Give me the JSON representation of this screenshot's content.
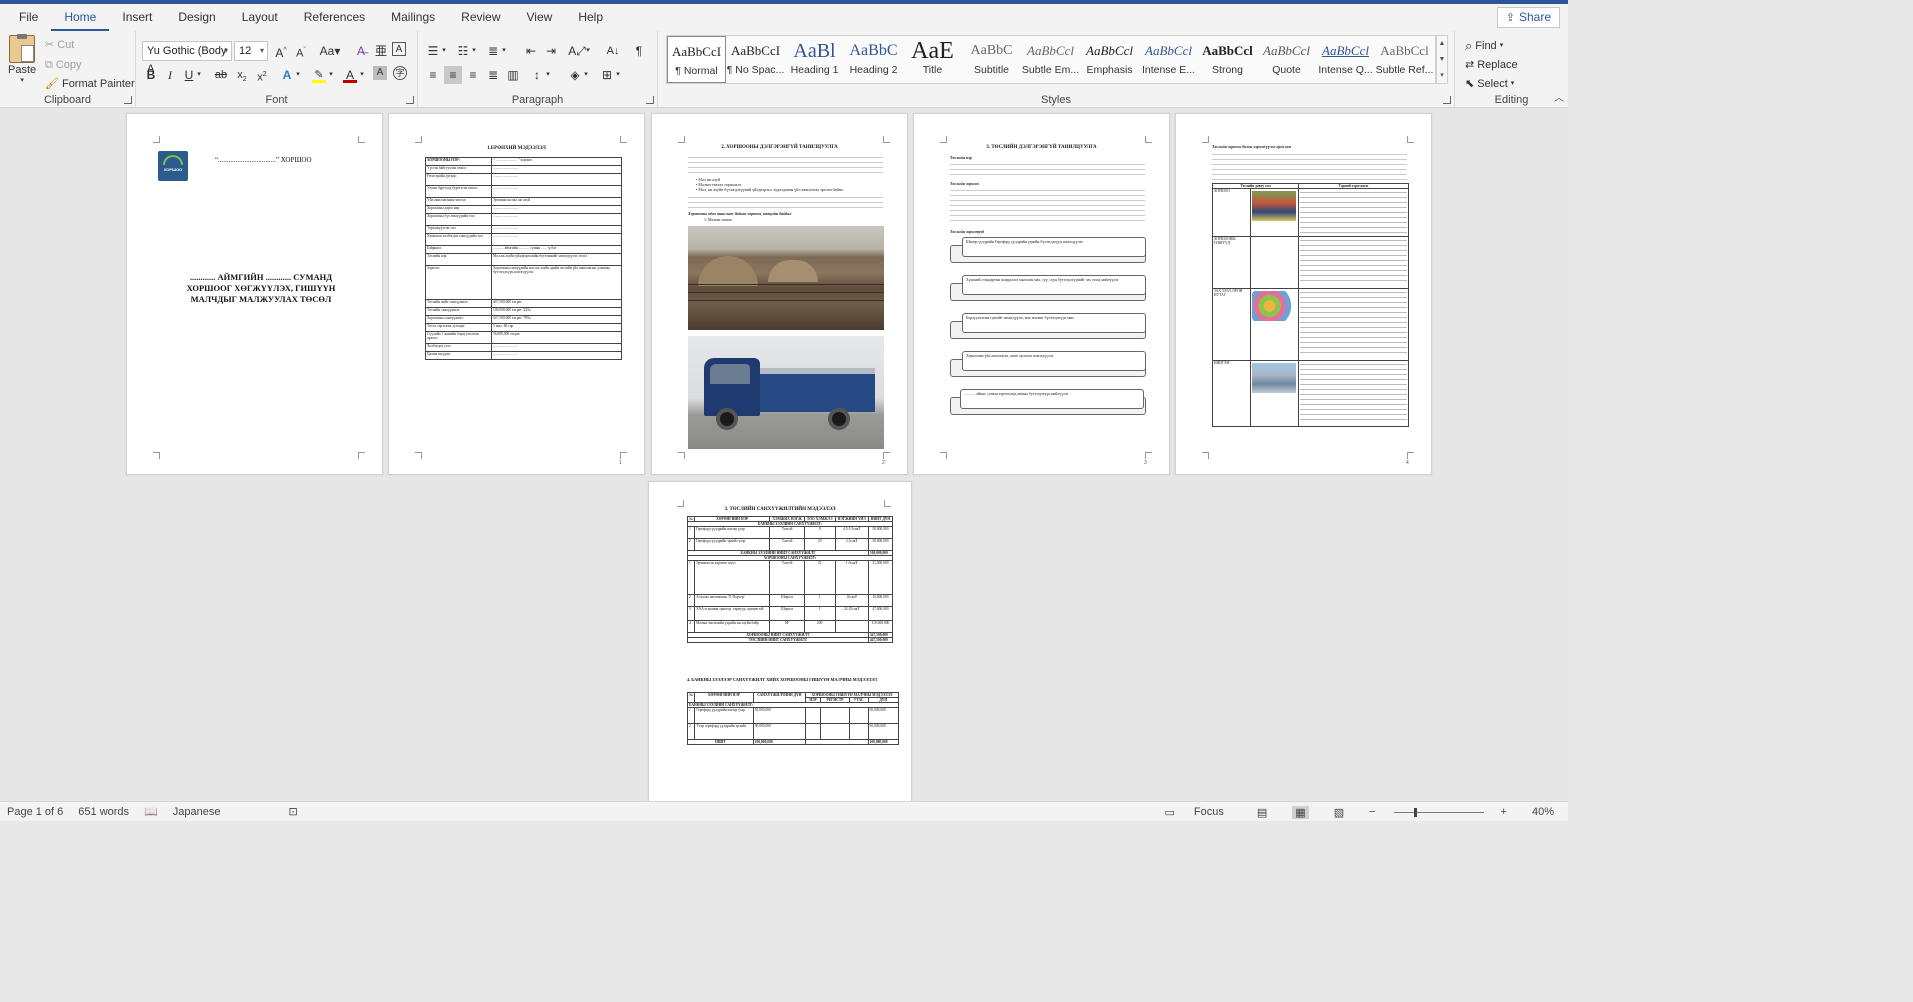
{
  "tabs": [
    "File",
    "Home",
    "Insert",
    "Design",
    "Layout",
    "References",
    "Mailings",
    "Review",
    "View",
    "Help"
  ],
  "active_tab": "Home",
  "share_label": "Share",
  "clipboard": {
    "label": "Clipboard",
    "paste": "Paste",
    "cut": "Cut",
    "copy": "Copy",
    "format_painter": "Format Painter"
  },
  "font": {
    "label": "Font",
    "family": "Yu Gothic (Body A",
    "size": "12",
    "font_color": "#c00000",
    "highlight_color": "#ffff00"
  },
  "paragraph": {
    "label": "Paragraph"
  },
  "styles": {
    "label": "Styles",
    "items": [
      {
        "preview": "AaBbCcI",
        "name": "¶ Normal"
      },
      {
        "preview": "AaBbCcI",
        "name": "¶ No Spac..."
      },
      {
        "preview": "AaBl",
        "name": "Heading 1"
      },
      {
        "preview": "AaBbC",
        "name": "Heading 2"
      },
      {
        "preview": "AaE",
        "name": "Title"
      },
      {
        "preview": "AaBbC",
        "name": "Subtitle"
      },
      {
        "preview": "AaBbCcl",
        "name": "Subtle Em..."
      },
      {
        "preview": "AaBbCcl",
        "name": "Emphasis"
      },
      {
        "preview": "AaBbCcl",
        "name": "Intense E..."
      },
      {
        "preview": "AaBbCcl",
        "name": "Strong"
      },
      {
        "preview": "AaBbCcl",
        "name": "Quote"
      },
      {
        "preview": "AaBbCcl",
        "name": "Intense Q..."
      },
      {
        "preview": "AaBbCcl",
        "name": "Subtle Ref..."
      }
    ]
  },
  "editing": {
    "label": "Editing",
    "find": "Find",
    "replace": "Replace",
    "select": "Select"
  },
  "pages": {
    "p1": {
      "header": "“.................................” ХОРШОО",
      "title": "............ АЙМГИЙН ............ СУМАНД ХОРШООГ ХӨГЖҮҮЛЭХ, ГИШҮҮН МАЛЧДЫГ МАЛЖУУЛАХ ТӨСӨЛ"
    },
    "p2": {
      "title": "1.ЕРӨНХИЙ МЭДЭЭЛЭЛ",
      "rows": [
        [
          "ХОРШООНЫ НЭР:",
          "“ ........................ ” хоршоо"
        ],
        [
          "Үүсгэн байгуулсан огноо:",
          "............................"
        ],
        [
          "Регистрийн дугаар:",
          "............................"
        ],
        [
          "Улсын бүртгэлд бүртгэсэн огноо:",
          "............................"
        ],
        [
          "Үйл ажиллагааны чиглэл:",
          "Эрчимжсэн мал аж ахуй"
        ],
        [
          "Хоршооны дарга нэр:",
          "............................"
        ],
        [
          "Хоршооны бүх гишүүдийн тоо:",
          "............................"
        ],
        [
          "Төрөлжүүлсэн тоо:",
          "............................"
        ],
        [
          "Хамаатан холбогдон гишүүдийн тоо:",
          "............................"
        ],
        [
          "Байршил:",
          "............ аймгийн ............ сумын ...... -р баг"
        ],
        [
          "Төслийн нэр:",
          "Мал аж ахуйн үйлдвэрлэлийн бүтээмжийг нэмэгдүүлэх төсөл"
        ],
        [
          "Зорилго:",
          "Хоршооны гишүүдийн мал аж ахуйн эдийн засгийн үйл ажиллагааг дэмжин, бүтээгдэхүүн нэмэгдүүлэх"
        ],
        [
          "Төслийн нийт санхүүжилт:",
          "447,500,000 төгрөг"
        ],
        [
          "Төслийн санхүүжилт:",
          "100,000,000 төгрөг /22%/"
        ],
        [
          "Хоршооны санхүүжилт:",
          "347,500,000 төгрөг /78%/"
        ],
        [
          "Төсөл хэрэгжих хугацаа:",
          "5 жил, 60 сар"
        ],
        [
          "Сүүлийн 1 жилийн борлуулалтын орлого:",
          "56,000,000 төгрөг"
        ],
        [
          "Холбогдох утас:",
          "............................"
        ],
        [
          "Цахим шуудан:",
          "............................"
        ]
      ]
    },
    "p3": {
      "title": "2.  ХОРШООНЫ ДЭЛГЭРЭНГҮЙ ТАНИЛЦУУЛГА",
      "bullets": [
        "Мал аж ахуй",
        "Малын тэжээл тариалалт",
        "Мал, аж ахуйн бүтээгдэхүүний үйлдвэрлэл, худалдааны үйл ажиллагаа эрхлэн байна."
      ],
      "subheading": "Хоршооны одоо ашиглаж байгаа хөрөнгө, нөөцийн байдал",
      "caption": "Малын хашаа"
    },
    "p4": {
      "title": "3.  ТӨСЛИЙН ДЭЛГЭРЭНГҮЙ ТАНИЛЦУУЛГА",
      "s1": "Төслийн нэр",
      "s2": "Төслийн зорилго",
      "s3": "Төслийн зорилтууд",
      "boxes": [
        "Шилэр үүлдрийн Герефорд үүлдрийн үхрийн бүтээгдэхүүн нэмэгдүүлэх",
        "Хүнсний стандартын шаардлага хангасан мах, сүү, сүүн бүтээгдэхүүнийг зах зээлд нийлүүлэх",
        "Борлуулалтын сувгийг нэмэгдүүлж, мах махмиг бүтээгдэхүүн авах",
        "Хоршооны үйл ажиллагаа, ашиг орлогыг нэмэгдүүлэх",
        "............ аймаг, сумын хэрэгцээнд махны бүтээгдэхүүн нийлүүлэх"
      ]
    },
    "p5": {
      "intro": "Төслийн зорилго болон хэрэгжүүлэх арга зам",
      "head": [
        "Төслийн давуу тал",
        "Тэрний хэрэгжилт"
      ],
      "rows": [
        "ХОРШОО",
        "ХОРШООНЫ ГИШҮҮД",
        "ЗАХ ЗЭЭЛ, ОРОН НУТАГ",
        "НИЙГЭМ"
      ]
    },
    "p6": {
      "title": "3.  ТӨСЛИЙН САНХҮҮЖИЛТИЙН МЭДЭЭЛЭЛ",
      "head": [
        "№",
        "ХӨРӨНГИЙН НЭР",
        "ХЭМЖИХ НЭГЖ",
        "ТОО ХЭМЖЭЭ",
        "НЭГЖИЙН ҮНЭ",
        "НИЙТ ДҮН"
      ],
      "bank_label": "БАНКНЫ ЗЭЭЛИЙН САНХҮҮЖИЛТ:",
      "bank_rows": [
        [
          "1",
          "Герефорд үүлдрийн шилэр үхэр",
          "Толгой",
          "9",
          "4.5-5.5сая₮",
          "50,000,000"
        ],
        [
          "2",
          "Герефорд үүлдрийн эрлийз үхэр",
          "Толгой",
          "20",
          "2.5сая₮",
          "50,000,000"
        ]
      ],
      "bank_total": [
        "БАНКНЫ ЗЭЭЛИЙН НИЙТ САНХҮҮЖИЛТ",
        "100,000,000"
      ],
      "coop_label": "ХОРШООНЫ САНХҮҮЖИЛТ:",
      "coop_rows": [
        [
          "1",
          "Эрчимжсэн хөрөнгө шуут",
          "Толгой",
          "21",
          "1.0сая₮",
          "21,000,000"
        ],
        [
          "2",
          "Алхалах автомашин /Х-Портер/",
          "Ширхэг",
          "1",
          "16сая₮",
          "16,000,000"
        ],
        [
          "3",
          "ХАА-н машин трактор, тармуур, прицептэй",
          "Ширхэг",
          "1",
          "22-25сая₮",
          "47,000,000"
        ],
        [
          "4",
          "Малын чиглэлийн үхрийн аж ахуйн байр",
          "М²",
          "200",
          "",
          "110,000,000"
        ]
      ],
      "coop_total": [
        "ХОРШООНЫ НИЙТ САНХҮҮЖИЛТ",
        "347,500,000"
      ],
      "grand_total": [
        "ТӨСЛИЙН НИЙТ САНХҮҮЖИЛТ",
        "447,500,000"
      ],
      "title2": "4.  БАНКНЫ ЗЭЭЛЭЭР САНХҮҮЖИЛТ ХИЙХ ХОРШООНЫ ГИШҮҮН МАЛЧНЫ МЭДЭЭЛЭЛ",
      "head2": [
        "№",
        "ХӨРӨНГИЙН НЭР",
        "САНХҮҮЖИЛТИЙН ДҮН",
        "НЭР",
        "РЕГИСТР",
        "УТАС",
        "ДҮН"
      ],
      "head2_group": "ХОРШООНЫ ГИШҮҮН МАЛЧНЫ МЭДЭЭЛЭЛ",
      "rows2": [
        [
          "1",
          "Герефорд үүлдрийн шилэр үхэр",
          "50,000,000",
          "50,000,000"
        ],
        [
          "2",
          "Үхэр герефорд үүлдрийн эрлийз",
          "50,000,000",
          "50,000,000"
        ]
      ],
      "total2": [
        "НИЙТ",
        "100,000,000",
        "100,000,000"
      ]
    },
    "page_numbers": [
      "1",
      "2",
      "3",
      "4",
      "5"
    ]
  },
  "status": {
    "page": "Page 1 of 6",
    "words": "651 words",
    "language": "Japanese",
    "focus": "Focus",
    "zoom": "40%"
  }
}
